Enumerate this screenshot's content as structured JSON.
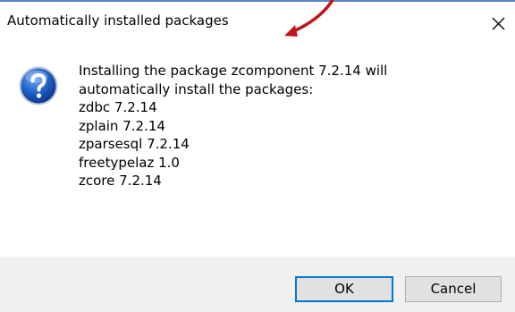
{
  "dialog": {
    "title": "Automatically installed packages",
    "icon": "question-icon",
    "message_lines": [
      "Installing the package zcomponent 7.2.14 will",
      "automatically install the packages:",
      "zdbc 7.2.14",
      "zplain 7.2.14",
      "zparsesql 7.2.14",
      "freetypelaz 1.0",
      "zcore 7.2.14"
    ],
    "buttons": {
      "ok": "OK",
      "cancel": "Cancel"
    }
  },
  "colors": {
    "accent": "#0078d7",
    "annotation_arrow": "#c0161b",
    "footer": "#f0f0f0"
  }
}
